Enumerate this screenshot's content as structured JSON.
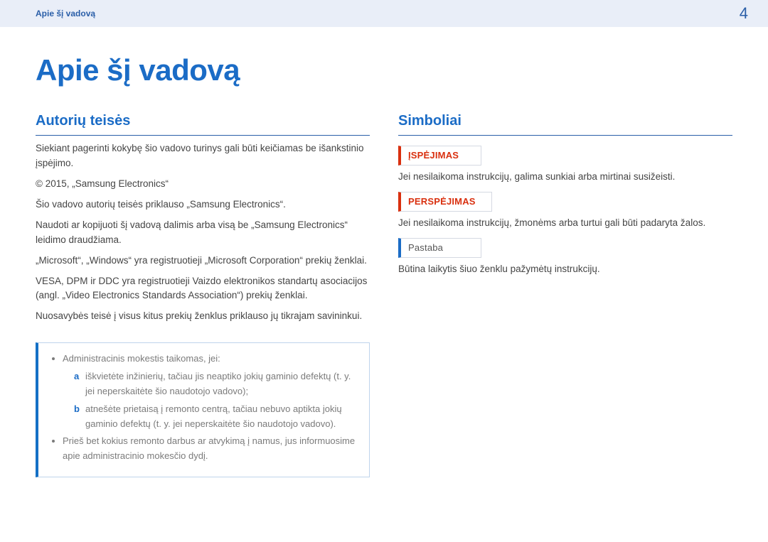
{
  "header": {
    "breadcrumb": "Apie šį vadovą",
    "page_number": "4"
  },
  "title": "Apie šį vadovą",
  "left": {
    "heading": "Autorių teisės",
    "paragraphs": [
      "Siekiant pagerinti kokybę šio vadovo turinys gali būti keičiamas be išankstinio įspėjimo.",
      "© 2015, „Samsung Electronics“",
      "Šio vadovo autorių teisės priklauso „Samsung Electronics“.",
      "Naudoti ar kopijuoti šį vadovą dalimis arba visą be „Samsung Electronics“ leidimo draudžiama.",
      "„Microsoft“, „Windows“ yra registruotieji „Microsoft Corporation“ prekių ženklai.",
      "VESA, DPM ir DDC yra registruotieji Vaizdo elektronikos standartų asociacijos (angl. „Video Electronics Standards Association“) prekių ženklai.",
      "Nuosavybės teisė į visus kitus prekių ženklus priklauso jų tikrajam savininkui."
    ],
    "box": {
      "lead": "Administracinis mokestis taikomas, jei:",
      "items": {
        "a": "iškvietėte inžinierių, tačiau jis neaptiko jokių gaminio defektų (t. y. jei neperskaitėte šio naudotojo vadovo);",
        "b": "atnešėte prietaisą į remonto centrą, tačiau nebuvo aptikta jokių gaminio defektų (t. y. jei neperskaitėte šio naudotojo vadovo)."
      },
      "tail": "Prieš bet kokius remonto darbus ar atvykimą į namus, jus informuosime apie administracinio mokesčio dydį."
    }
  },
  "right": {
    "heading": "Simboliai",
    "warning_label": "ĮSPĖJIMAS",
    "warning_text": "Jei nesilaikoma instrukcijų, galima sunkiai arba mirtinai susižeisti.",
    "caution_label": "PERSPĖJIMAS",
    "caution_text": "Jei nesilaikoma instrukcijų, žmonėms arba turtui gali būti padaryta žalos.",
    "note_label": "Pastaba",
    "note_text": "Būtina laikytis šiuo ženklu pažymėtų instrukcijų."
  }
}
